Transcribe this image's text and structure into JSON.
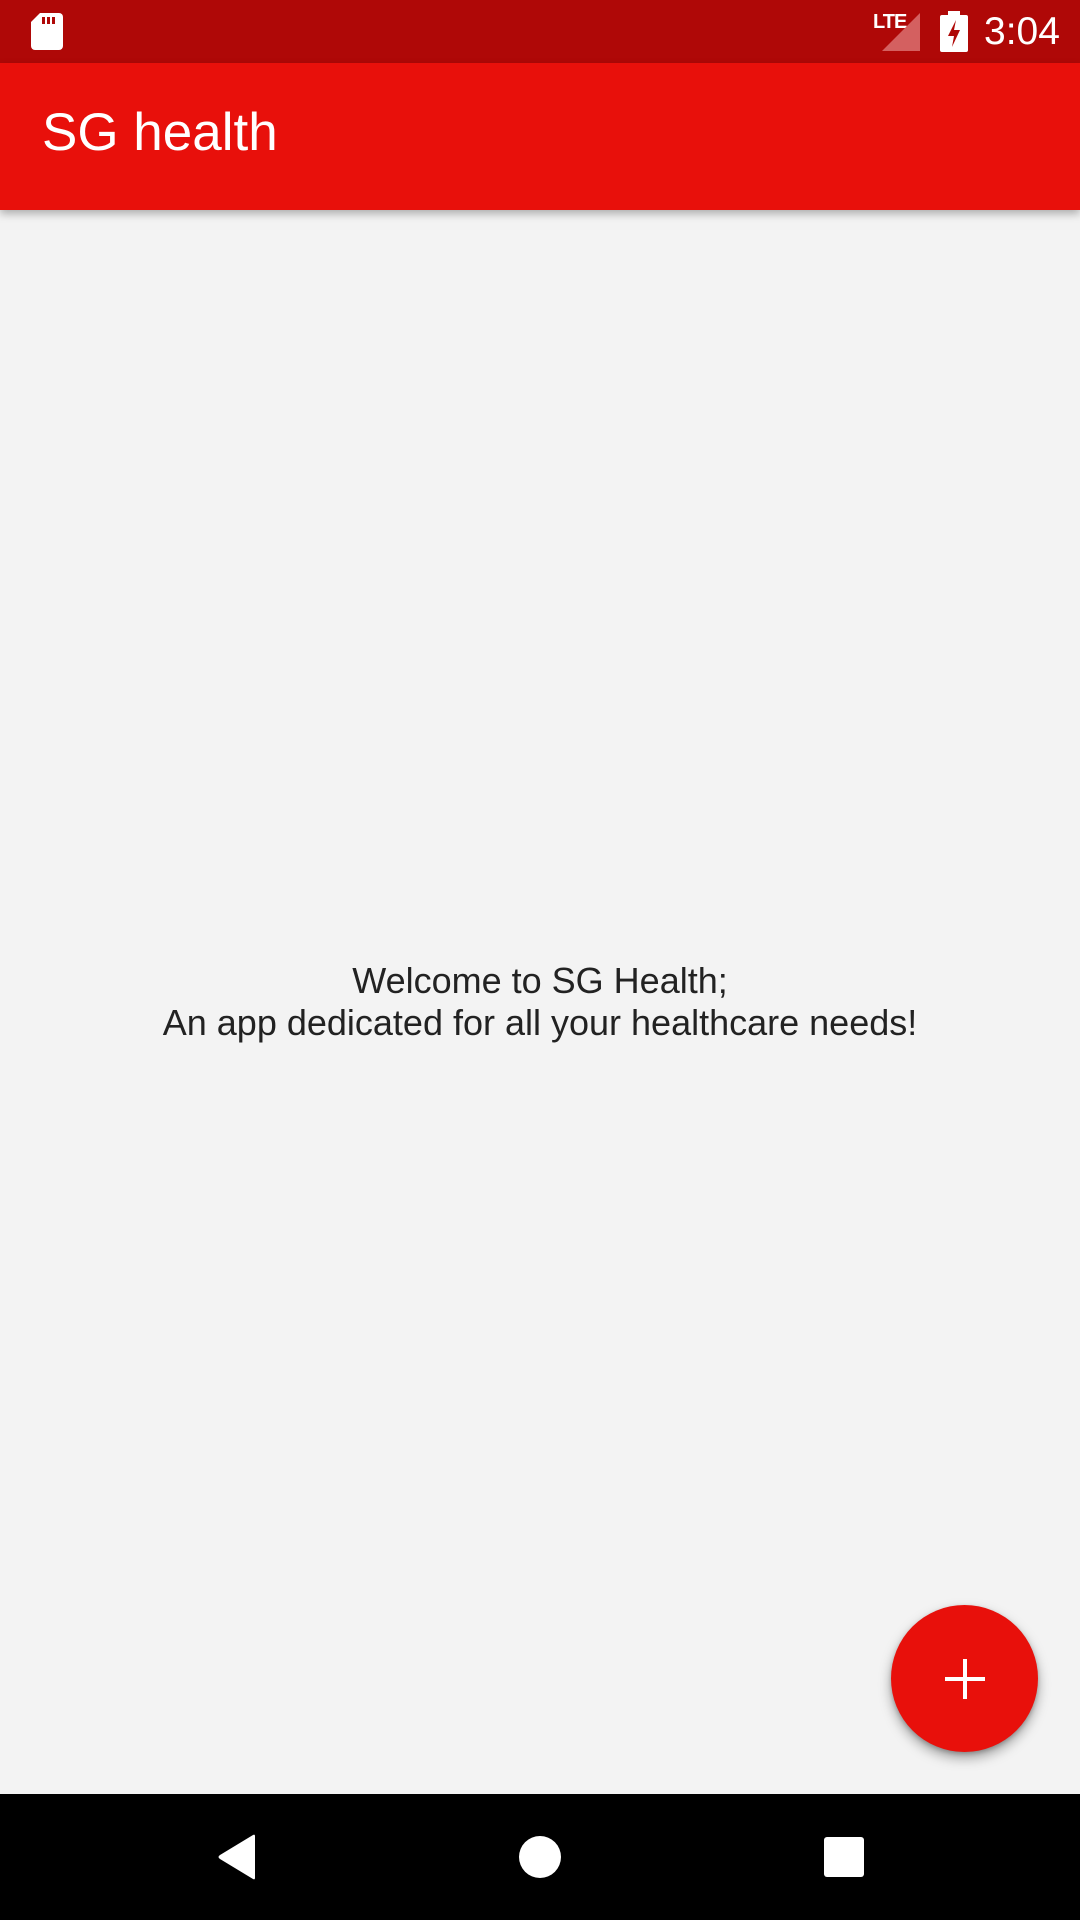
{
  "status_bar": {
    "time": "3:04",
    "network_label": "LTE",
    "icons": [
      "sd-card-icon",
      "cellular-signal-icon",
      "battery-charging-icon"
    ],
    "background": "#af0807"
  },
  "app_bar": {
    "title": "SG health",
    "background": "#e8100b"
  },
  "main": {
    "welcome_line1": "Welcome to SG Health;",
    "welcome_line2": "An app dedicated for all your healthcare needs!"
  },
  "fab": {
    "icon": "plus-icon",
    "background": "#e8100b"
  },
  "nav_bar": {
    "buttons": [
      "back-icon",
      "home-icon",
      "recents-icon"
    ],
    "background": "#000000"
  }
}
